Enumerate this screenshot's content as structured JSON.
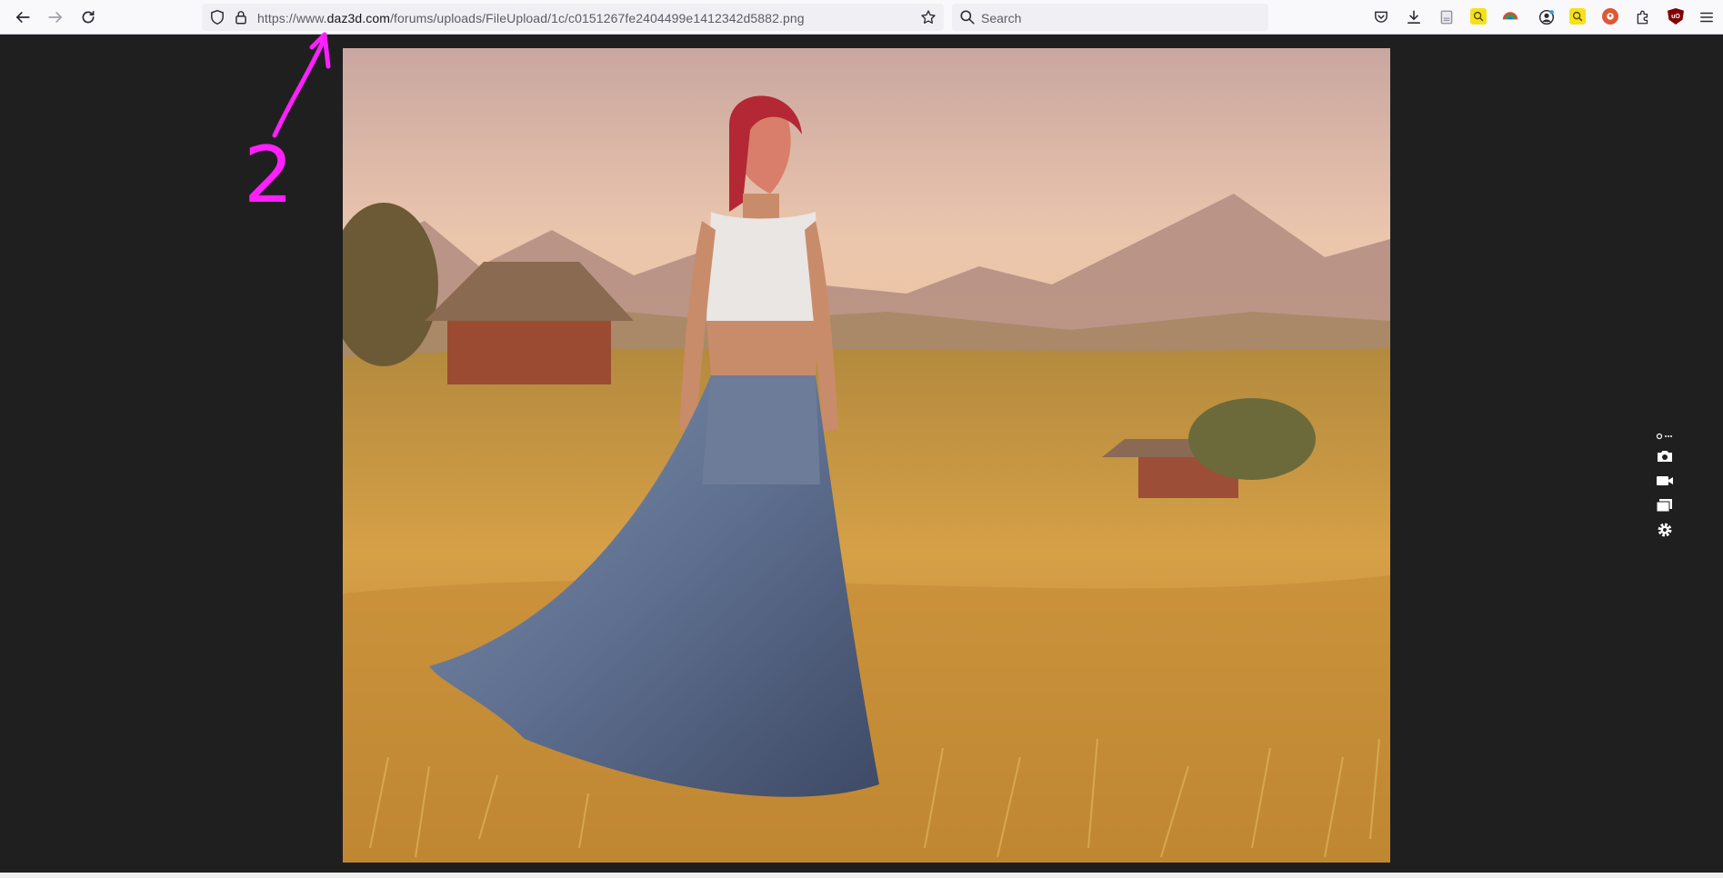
{
  "browser": {
    "url": {
      "prefix": "https://www.",
      "domain": "daz3d.com",
      "path": "/forums/uploads/FileUpload/1c/c0151267fe2404499e1412342d5882.png"
    },
    "search_placeholder": "Search"
  },
  "annotation": {
    "number": "2",
    "color": "#ff1fff"
  },
  "colors": {
    "viewer_bg": "#1f1f1f",
    "toolbar_bg": "#f9f9fb"
  },
  "icons": {
    "nav": [
      "back-icon",
      "forward-icon",
      "reload-icon"
    ],
    "url": [
      "tracking-shield-icon",
      "lock-icon",
      "bookmark-star-icon"
    ],
    "toolbar": [
      "pocket-icon",
      "downloads-icon",
      "reader-icon",
      "extension-icon",
      "extension-icon",
      "account-icon",
      "extension-icon",
      "duckduckgo-icon",
      "extensions-puzzle-icon",
      "ublock-icon",
      "menu-icon"
    ],
    "viewer": [
      "link-more-icon",
      "camera-icon",
      "video-icon",
      "gallery-icon",
      "settings-icon"
    ]
  },
  "ublock_badge": "uO"
}
